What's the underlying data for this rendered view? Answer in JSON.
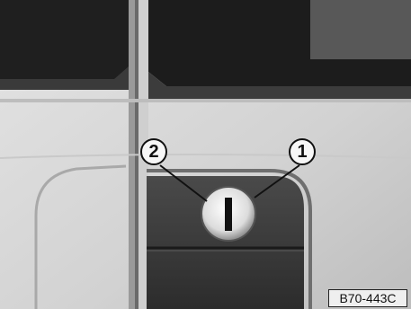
{
  "callouts": [
    {
      "label": "1"
    },
    {
      "label": "2"
    }
  ],
  "figure_code": "B70-443C"
}
